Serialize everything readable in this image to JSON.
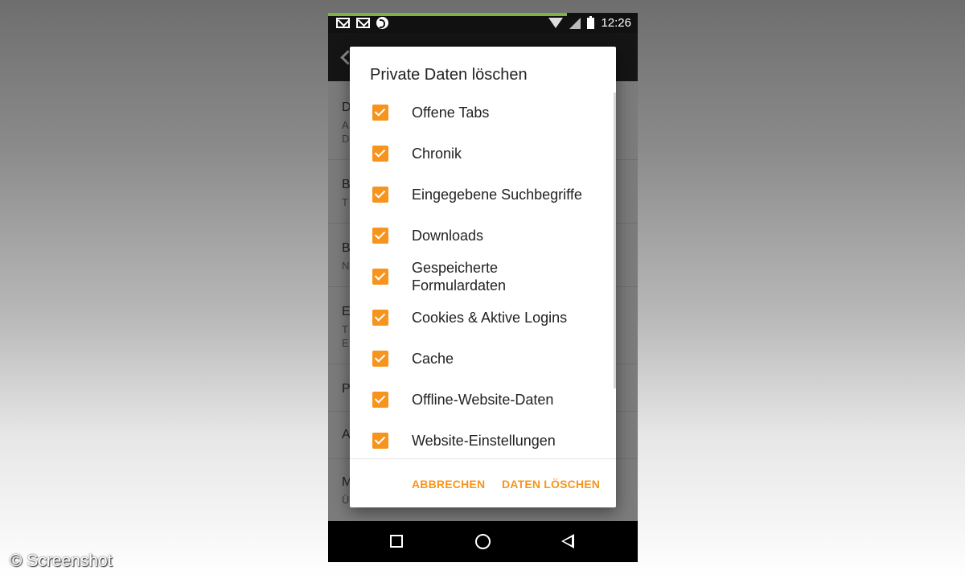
{
  "status_bar": {
    "time": "12:26",
    "icons": [
      "gmail-icon",
      "mail-icon",
      "app-notification-icon",
      "wifi-icon",
      "signal-icon",
      "battery-icon"
    ]
  },
  "background_settings": {
    "items": [
      {
        "letter": "D",
        "sub1": "A",
        "sub2": "D"
      },
      {
        "letter": "B",
        "sub1": "T"
      },
      {
        "letter": "B",
        "sub1": "N"
      },
      {
        "letter": "E",
        "sub1": "T",
        "sub2": "E"
      },
      {
        "letter": "P"
      },
      {
        "letter": "A"
      },
      {
        "letter": "M",
        "sub1": "Ü"
      }
    ]
  },
  "dialog": {
    "title": "Private Daten löschen",
    "options": [
      {
        "label": "Offene Tabs",
        "checked": true
      },
      {
        "label": "Chronik",
        "checked": true
      },
      {
        "label": "Eingegebene Suchbegriffe",
        "checked": true
      },
      {
        "label": "Downloads",
        "checked": true
      },
      {
        "label": "Gespeicherte Formulardaten",
        "checked": true
      },
      {
        "label": "Cookies & Aktive Logins",
        "checked": true
      },
      {
        "label": "Cache",
        "checked": true
      },
      {
        "label": "Offline-Website-Daten",
        "checked": true
      },
      {
        "label": "Website-Einstellungen",
        "checked": true
      }
    ],
    "cancel_label": "ABBRECHEN",
    "confirm_label": "DATEN LÖSCHEN"
  },
  "colors": {
    "accent": "#f7941d",
    "progress": "#7cb342"
  },
  "watermark": "© Screenshot"
}
